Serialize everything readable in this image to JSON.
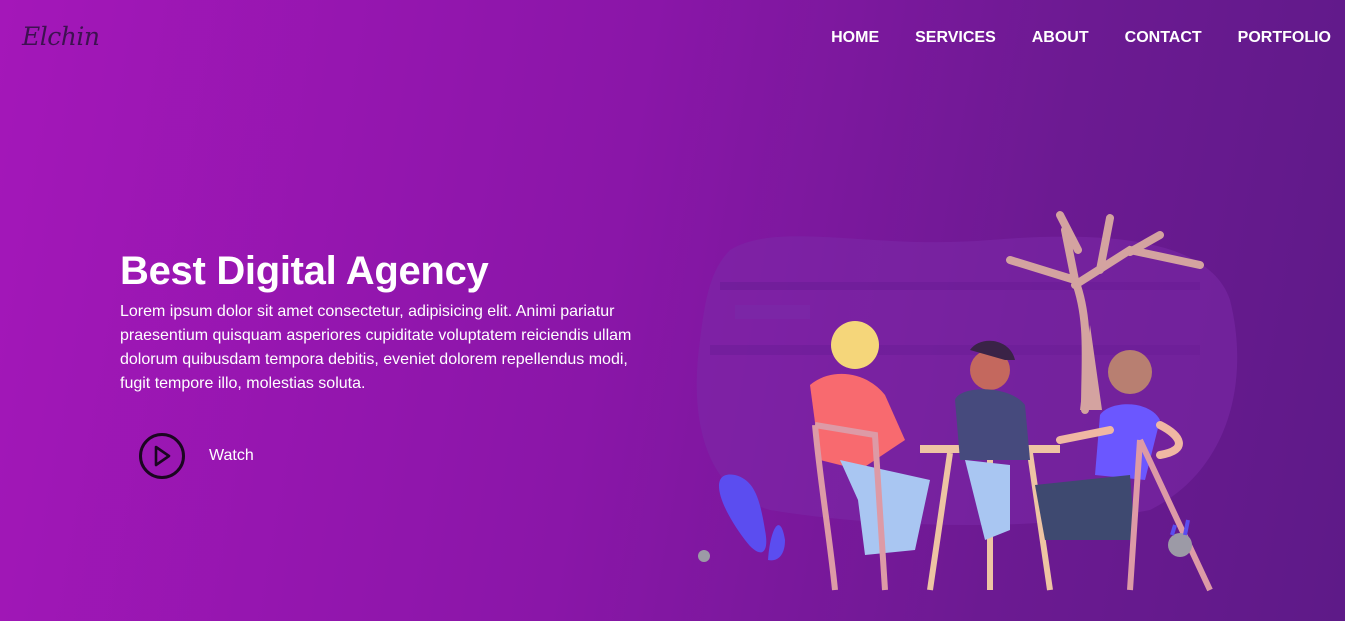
{
  "brand": {
    "logo_text": "Elchin"
  },
  "nav": {
    "items": [
      "HOME",
      "SERVICES",
      "ABOUT",
      "CONTACT",
      "PORTFOLIO"
    ]
  },
  "hero": {
    "title": "Best Digital Agency",
    "description": "Lorem ipsum dolor sit amet consectetur, adipisicing elit. Animi pariatur praesentium quisquam asperiores cupiditate voluptatem reiciendis ullam dolorum quibusdam tempora debitis, eveniet dolorem repellendus modi, fugit tempore illo, molestias soluta.",
    "watch_label": "Watch"
  },
  "colors": {
    "gradient_start": "#a417b9",
    "gradient_end": "#5e1a88",
    "text": "#ffffff"
  },
  "icons": {
    "play": "play-icon"
  }
}
